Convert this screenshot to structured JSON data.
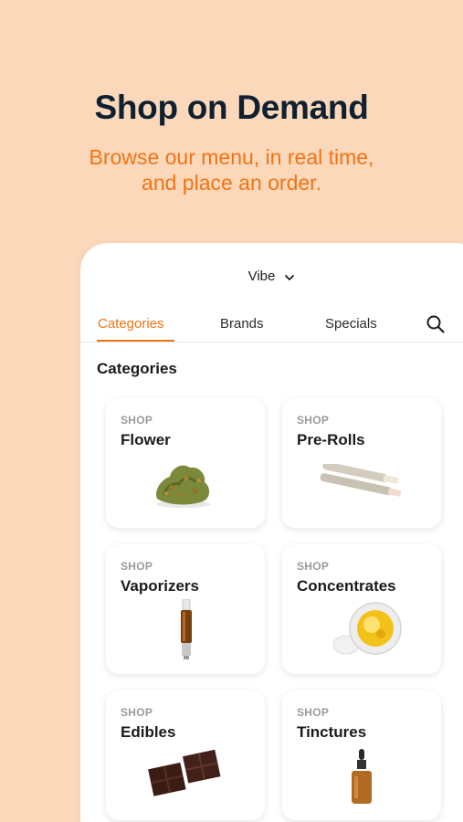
{
  "promo": {
    "headline": "Shop on Demand",
    "subline": "Browse our menu, in real time, and place an order."
  },
  "header": {
    "store_name": "Vibe"
  },
  "tabs": [
    {
      "label": "Categories",
      "active": true
    },
    {
      "label": "Brands",
      "active": false
    },
    {
      "label": "Specials",
      "active": false
    }
  ],
  "section_title": "Categories",
  "categories": [
    {
      "eyebrow": "SHOP",
      "name": "Flower",
      "icon": "flower-bud-icon"
    },
    {
      "eyebrow": "SHOP",
      "name": "Pre-Rolls",
      "icon": "pre-roll-icon"
    },
    {
      "eyebrow": "SHOP",
      "name": "Vaporizers",
      "icon": "vape-cartridge-icon"
    },
    {
      "eyebrow": "SHOP",
      "name": "Concentrates",
      "icon": "concentrate-jar-icon"
    },
    {
      "eyebrow": "SHOP",
      "name": "Edibles",
      "icon": "chocolate-icon"
    },
    {
      "eyebrow": "SHOP",
      "name": "Tinctures",
      "icon": "dropper-bottle-icon"
    }
  ],
  "colors": {
    "background": "#fcd8bb",
    "accent": "#f27413",
    "headline": "#0f2030"
  }
}
